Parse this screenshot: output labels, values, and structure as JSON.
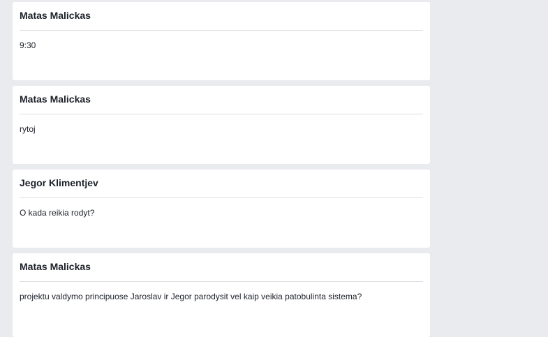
{
  "comments": [
    {
      "author": "Matas Malickas",
      "message": "9:30"
    },
    {
      "author": "Matas Malickas",
      "message": "rytoj"
    },
    {
      "author": "Jegor Klimentjev",
      "message": "O kada reikia rodyt?"
    },
    {
      "author": "Matas Malickas",
      "message": "projektu valdymo principuose Jaroslav ir Jegor parodysit vel kaip veikia patobulinta sistema?"
    }
  ],
  "colors": {
    "background": "#e9ebee",
    "card": "#ffffff",
    "divider": "#dddfe2",
    "text": "#1d2129"
  }
}
